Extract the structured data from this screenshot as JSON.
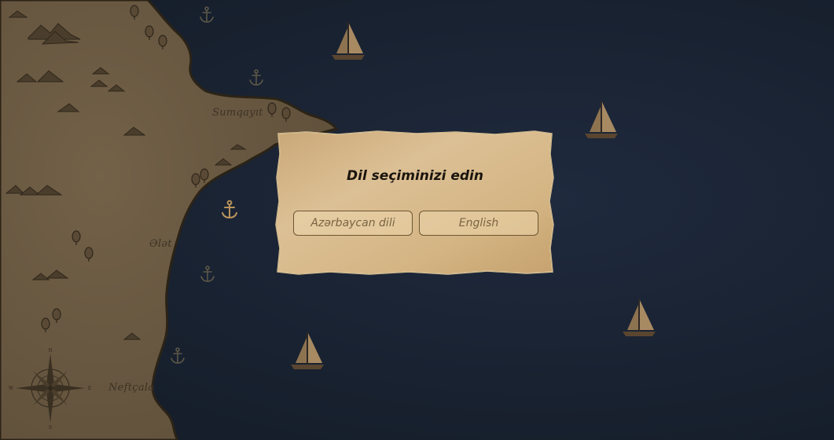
{
  "map": {
    "places": {
      "sumqayit": "Sumqayıt",
      "alat": "Ələt",
      "neftcala": "Neftçala"
    },
    "colors": {
      "sea": "#1b2436",
      "land": "#6b5a42",
      "coast": "#2e2517",
      "parchment": "#d9bc8c"
    },
    "compass_letters": {
      "north": "N",
      "south": "S",
      "east": "E",
      "west": "W"
    },
    "icons": [
      "anchor-icon",
      "sailboat-icon",
      "tree-icon",
      "mountain-icon",
      "compass-rose-icon"
    ]
  },
  "dialog": {
    "title": "Dil seçiminizi edin",
    "buttons": {
      "azerbaijani": "Azərbaycan dili",
      "english": "English"
    }
  }
}
